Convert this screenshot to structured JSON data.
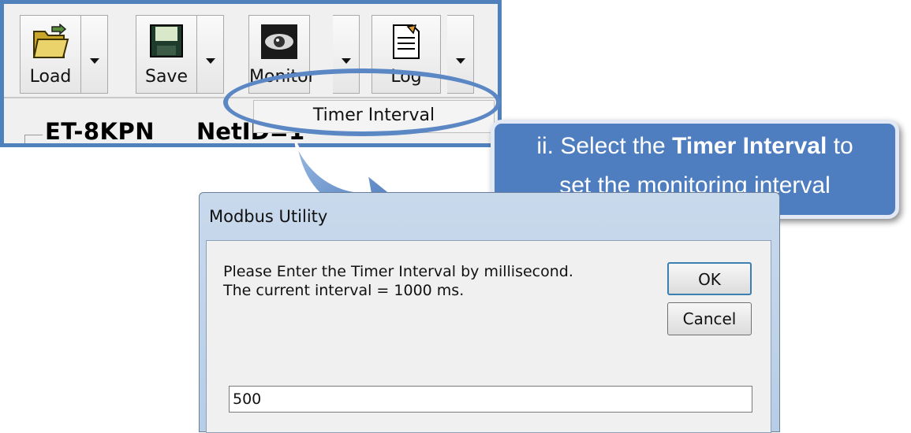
{
  "toolbar": {
    "buttons": [
      {
        "label": "Load"
      },
      {
        "label": "Save"
      },
      {
        "label": "Monitor"
      },
      {
        "label": "Log"
      }
    ],
    "device": "ET-8KPN",
    "netid": "NetID=1"
  },
  "menu": {
    "item": "Timer Interval"
  },
  "callout": {
    "line1_prefix": "ii. Select the ",
    "line1_bold": "Timer Interval",
    "line1_suffix": " to",
    "line2": "set the monitoring interval"
  },
  "dialog": {
    "title": "Modbus Utility",
    "message_line1": "Please Enter the Timer Interval by millisecond.",
    "message_line2": "The current interval = 1000 ms.",
    "ok_label": "OK",
    "cancel_label": "Cancel",
    "input_value": "500"
  },
  "colors": {
    "accent": "#4f7ec0",
    "highlight": "#5b87c4"
  }
}
